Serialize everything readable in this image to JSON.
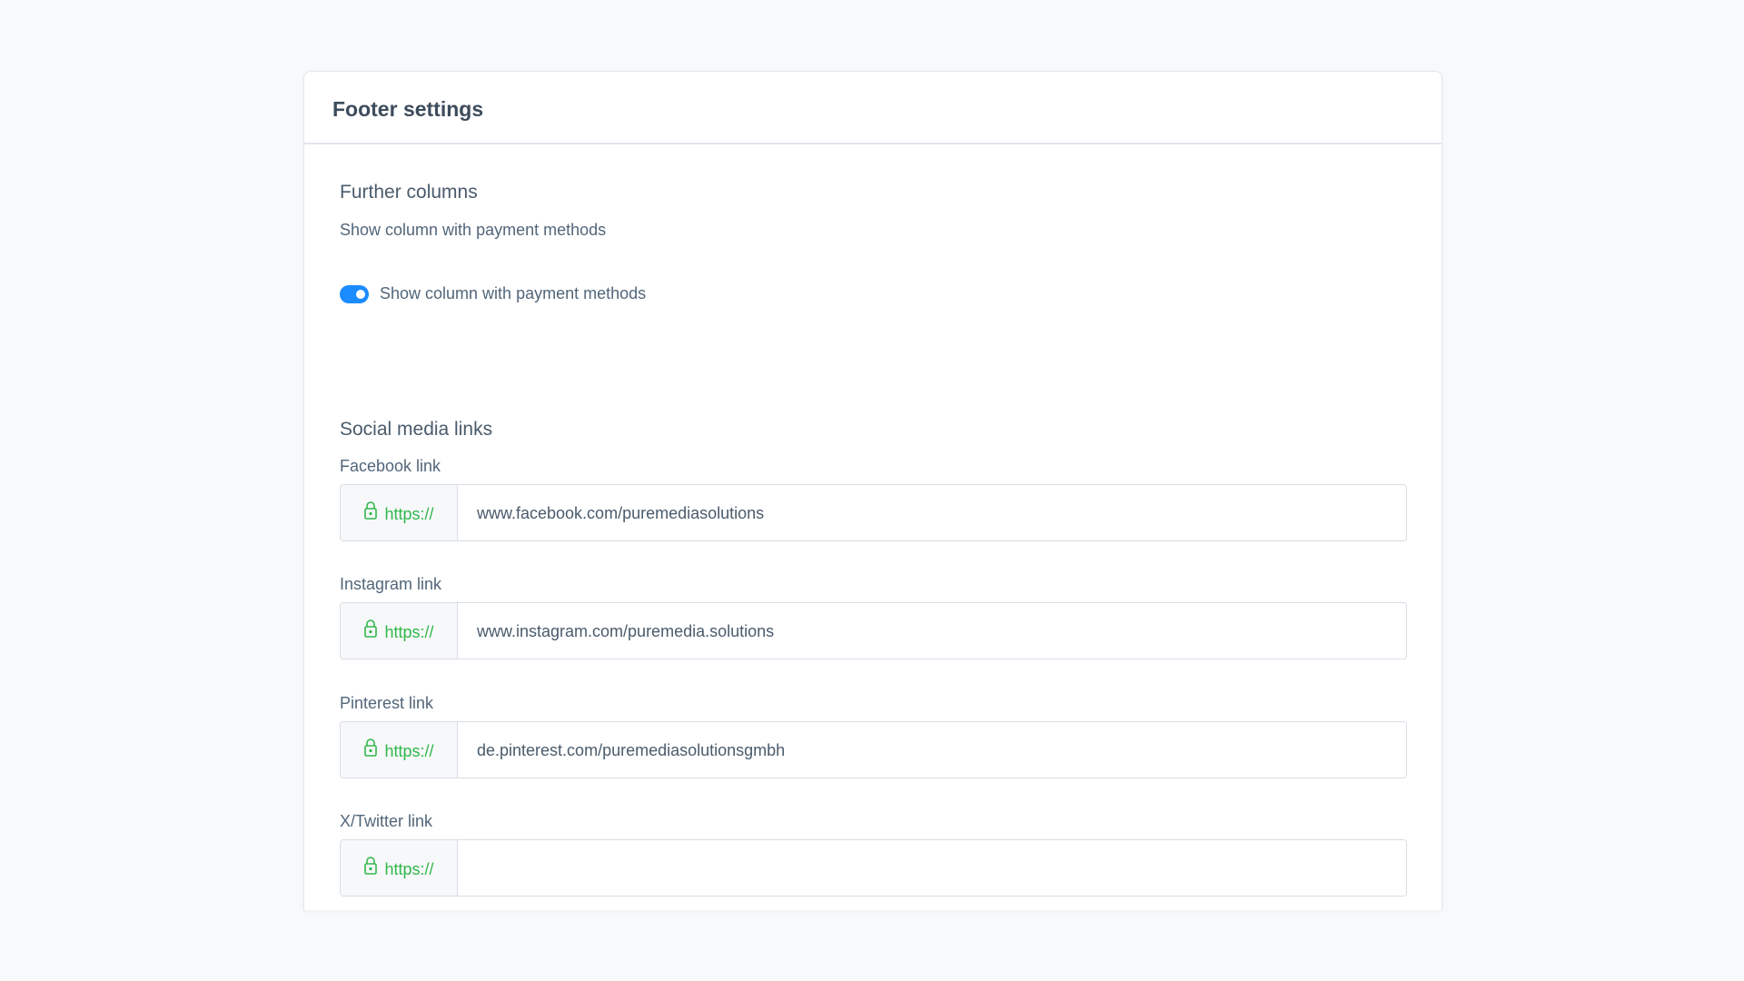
{
  "card": {
    "title": "Footer settings"
  },
  "further_columns": {
    "title": "Further columns",
    "sub_label": "Show column with payment methods",
    "toggle_label": "Show column with payment methods",
    "toggle_on": true
  },
  "social": {
    "title": "Social media links",
    "prefix": "https://",
    "fields": [
      {
        "label": "Facebook link",
        "value": "www.facebook.com/puremediasolutions"
      },
      {
        "label": "Instagram link",
        "value": "www.instagram.com/puremedia.solutions"
      },
      {
        "label": "Pinterest link",
        "value": "de.pinterest.com/puremediasolutionsgmbh"
      },
      {
        "label": "X/Twitter link",
        "value": ""
      }
    ]
  },
  "colors": {
    "accent": "#1a8cff",
    "prefix_green": "#30b74a",
    "background": "#f8f9fb"
  },
  "icons": {
    "prefix_icon": "lock-icon"
  }
}
